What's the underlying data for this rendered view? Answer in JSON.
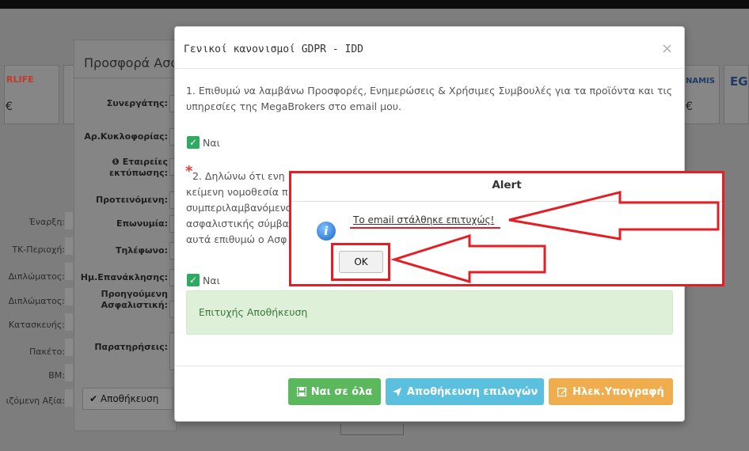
{
  "topbar": {},
  "logos": {
    "left_partial": "RLIFE",
    "left_partial_sub": "€",
    "right1": "NAMIS",
    "right1_sub": "€",
    "right2": "EG"
  },
  "background_form": {
    "title": "Προσφορά Ασφ",
    "left_labels": [
      "Έναρξη:",
      "ΤΚ-Περιοχή:",
      "Διπλώματος:",
      "Διπλώματος:",
      "Κατασκευής:",
      "Πακέτο:",
      "BM:",
      "ιζόμενη Αξία:"
    ],
    "fields": [
      "Συνεργάτης:",
      "Αρ.Κυκλοφορίας:",
      "Εταιρείες εκτύπωσης:",
      "Προτεινόμενη:",
      "Επωνυμία:",
      "Τηλέφωνο:",
      "Ημ.Επανάκλησης:",
      "Προηγούμενη Ασφαλιστική:",
      "Παρατηρήσεις:"
    ],
    "info_glyph": "❶",
    "save_label": "Αποθήκευση",
    "save_icon": "✔"
  },
  "gdpr_modal": {
    "title": "Γενικοί κανονισμοί GDPR - IDD",
    "close": "×",
    "p1_line1": "1. Επιθυμώ να λαμβάνω Προσφορές, Ενημερώσεις & Χρήσιμες Συμβουλές για τα προϊόντα και τις",
    "p1_line2": "υπηρεσίες της MegaBrokers στο email μου.",
    "yes1": "Ναι",
    "required_mark": "*",
    "p2_line1": "2. Δηλώνω ότι ενη",
    "p2_line2": "κείμενη νομοθεσία π",
    "p2_line3": "συμπεριλαμβανόμενο",
    "p2_line4": "ασφαλιστικής σύμβα",
    "p2_line5": "αυτά επιθυμώ ο Ασφ",
    "yes2": "Ναι",
    "success_text": "Επιτυχής Αποθήκευση",
    "buttons": {
      "yes_all": "Ναι σε όλα",
      "save_choices": "Αποθήκευση επιλογών",
      "esign": "Ηλεκ.Υπογραφή"
    },
    "checkmark": "✓"
  },
  "alert": {
    "title": "Alert",
    "message": "Το email στάλθηκε επιτυχώς!",
    "ok": "OK",
    "icon_glyph": "i"
  },
  "colors": {
    "annotation_red": "#e31e24",
    "green": "#5cb85c",
    "blue": "#5bc0de",
    "orange": "#f0ad4e",
    "success_bg": "#dff0d8"
  }
}
